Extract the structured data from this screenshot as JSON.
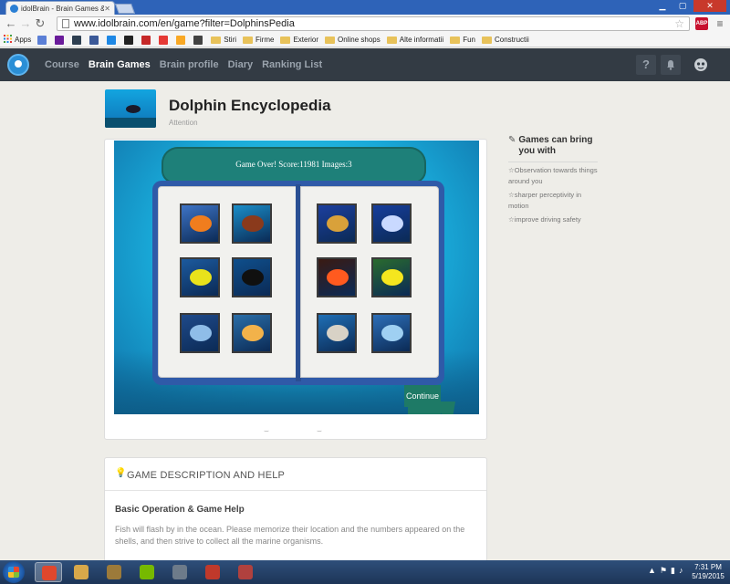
{
  "browser": {
    "tab_title": "idolBrain - Brain Games &",
    "url": "www.idolbrain.com/en/game?filter=DolphinsPedia",
    "abp_label": "ABP",
    "bookmarks": [
      {
        "label": "Apps",
        "kind": "apps"
      },
      {
        "label": "",
        "kind": "icon",
        "color": "#5b7fd6"
      },
      {
        "label": "",
        "kind": "icon",
        "color": "#6a1b9a"
      },
      {
        "label": "",
        "kind": "icon",
        "color": "#2d3e50"
      },
      {
        "label": "",
        "kind": "icon",
        "color": "#3b5998"
      },
      {
        "label": "",
        "kind": "icon",
        "color": "#1e88e5"
      },
      {
        "label": "",
        "kind": "icon",
        "color": "#222222"
      },
      {
        "label": "",
        "kind": "icon",
        "color": "#c62828"
      },
      {
        "label": "",
        "kind": "icon",
        "color": "#e53935"
      },
      {
        "label": "",
        "kind": "icon",
        "color": "#f9a825"
      },
      {
        "label": "",
        "kind": "icon",
        "color": "#424242"
      },
      {
        "label": "Stiri",
        "kind": "folder"
      },
      {
        "label": "Firme",
        "kind": "folder"
      },
      {
        "label": "Exterior",
        "kind": "folder"
      },
      {
        "label": "Online shops",
        "kind": "folder"
      },
      {
        "label": "Alte informatii",
        "kind": "folder"
      },
      {
        "label": "Fun",
        "kind": "folder"
      },
      {
        "label": "Constructii",
        "kind": "folder"
      }
    ]
  },
  "nav": {
    "links": [
      "Course",
      "Brain Games",
      "Brain profile",
      "Diary",
      "Ranking List"
    ],
    "active": "Brain Games",
    "help_glyph": "?",
    "bell_glyph": "♪"
  },
  "game": {
    "title": "Dolphin Encyclopedia",
    "subtitle": "Attention",
    "status": "Game Over!  Score:11981  Images:3",
    "continue_label": "Continue",
    "dots": [
      "⌣",
      "⌣"
    ],
    "images": [
      {
        "bg": "#3e74c6",
        "fg": "#f07d1e"
      },
      {
        "bg": "#1a8ec9",
        "fg": "#8a3a1c"
      },
      {
        "bg": "#1c3f9e",
        "fg": "#d9a13a"
      },
      {
        "bg": "#173e9c",
        "fg": "#c9d9ff"
      },
      {
        "bg": "#1c5a9e",
        "fg": "#e9e21b"
      },
      {
        "bg": "#0f4f8c",
        "fg": "#101010"
      },
      {
        "bg": "#3a1a12",
        "fg": "#ff5a1f"
      },
      {
        "bg": "#2a6b2e",
        "fg": "#f5e61e"
      },
      {
        "bg": "#1f4a8a",
        "fg": "#8fbde8"
      },
      {
        "bg": "#2a6ea8",
        "fg": "#f2b24a"
      },
      {
        "bg": "#1f6fb5",
        "fg": "#d8d2c6"
      },
      {
        "bg": "#2d6fb8",
        "fg": "#9fd0f2"
      }
    ]
  },
  "sidebar": {
    "heading": "Games can bring you with",
    "items": [
      "☆Observation towards things around you",
      "☆sharper perceptivity in motion",
      "☆improve driving safety"
    ]
  },
  "description": {
    "heading": "GAME DESCRIPTION AND HELP",
    "subheading": "Basic Operation & Game Help",
    "body": "Fish will flash by in the ocean. Please memorize their location and the numbers appeared on the shells, and then strive to collect all the marine organisms."
  },
  "taskbar": {
    "time": "7:31 PM",
    "date": "5/19/2015",
    "apps": [
      {
        "color": "#e0472d"
      },
      {
        "color": "#d8a84a"
      },
      {
        "color": "#9c7a3a"
      },
      {
        "color": "#76b900"
      },
      {
        "color": "#6d7b8a"
      },
      {
        "color": "#c0392b"
      },
      {
        "color": "#b0413e"
      }
    ]
  }
}
